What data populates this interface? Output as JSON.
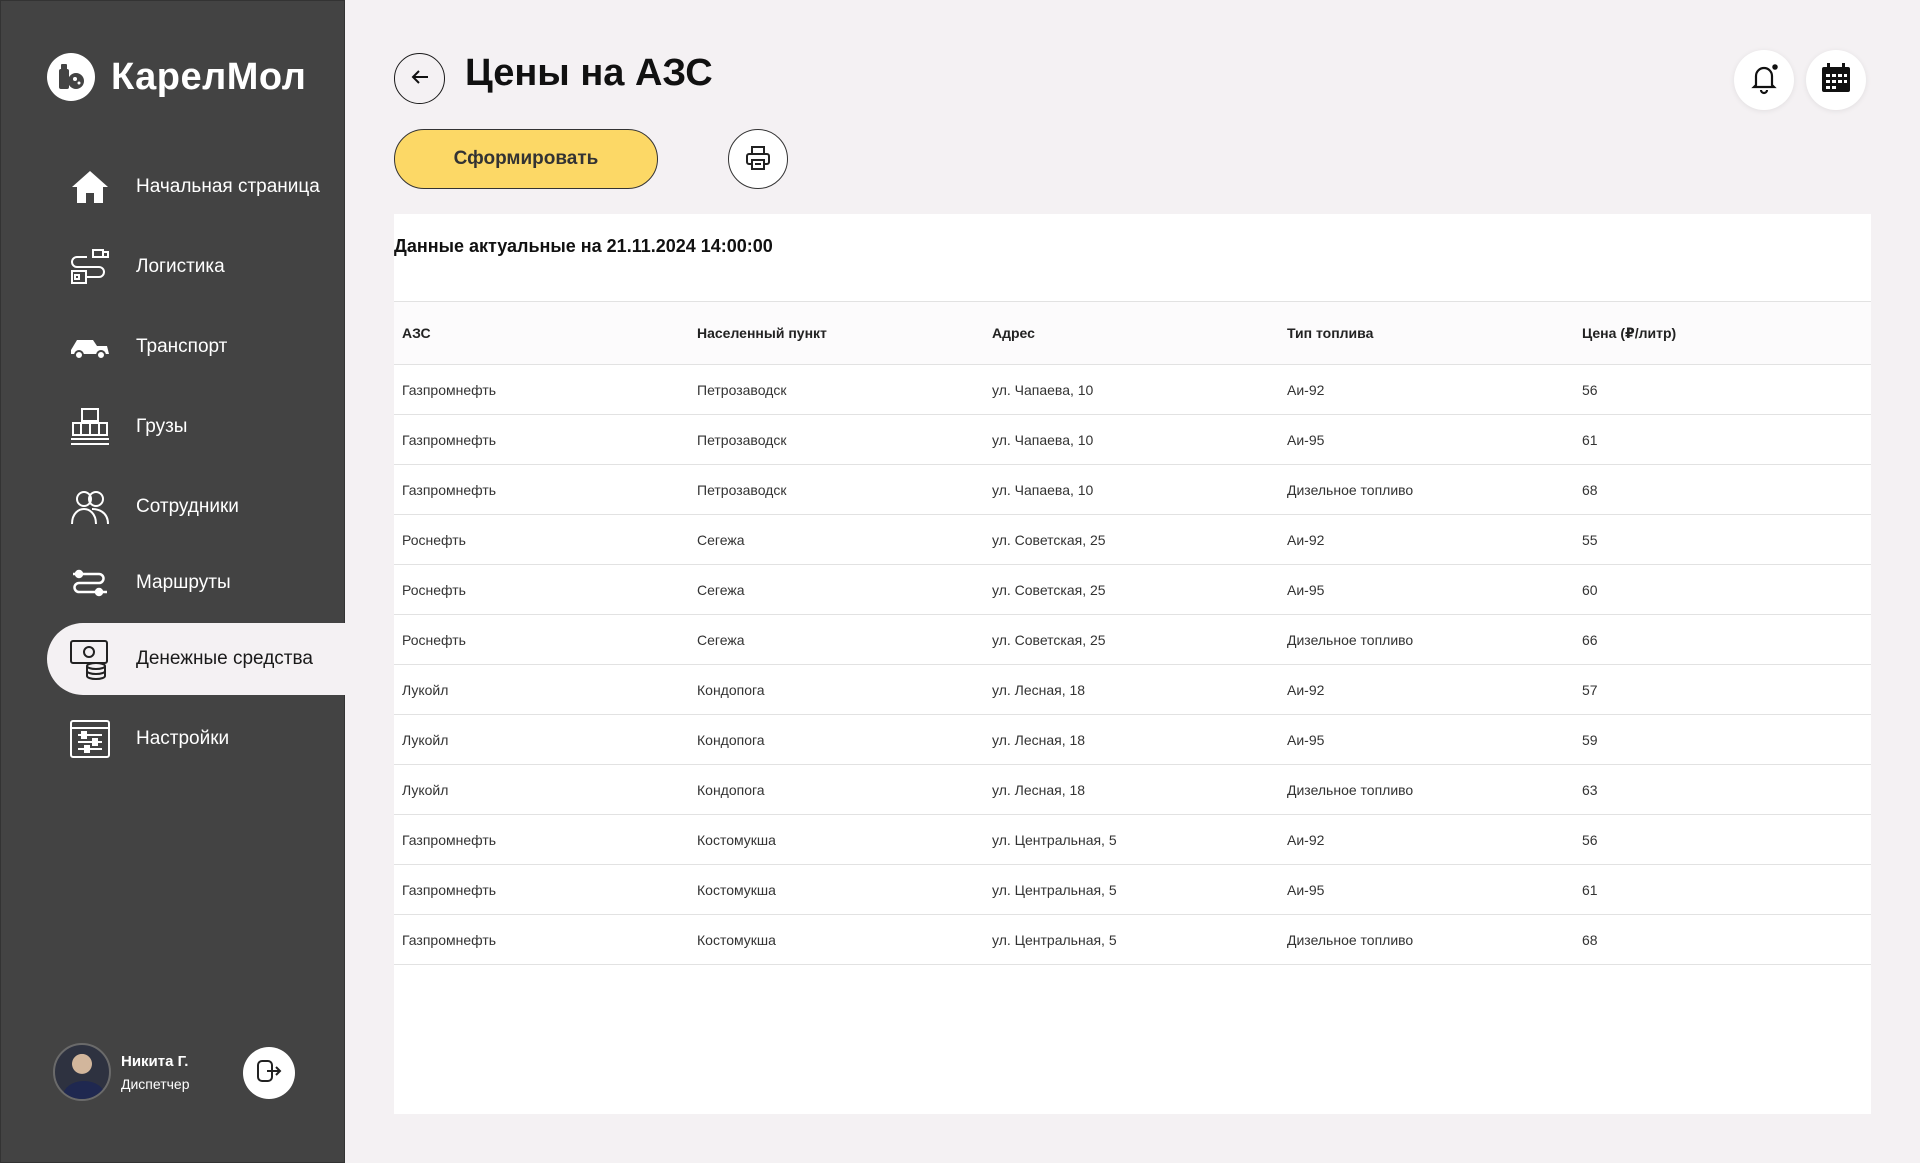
{
  "brand": {
    "name": "КарелМол"
  },
  "sidebar": {
    "items": [
      {
        "label": "Начальная страница",
        "icon": "home-icon"
      },
      {
        "label": "Логистика",
        "icon": "logistics-icon"
      },
      {
        "label": "Транспорт",
        "icon": "transport-icon"
      },
      {
        "label": "Грузы",
        "icon": "cargo-icon"
      },
      {
        "label": "Сотрудники",
        "icon": "employees-icon"
      },
      {
        "label": "Маршруты",
        "icon": "routes-icon"
      },
      {
        "label": "Денежные средства",
        "icon": "money-icon",
        "active": true
      },
      {
        "label": "Настройки",
        "icon": "settings-icon"
      }
    ]
  },
  "user": {
    "name": "Никита Г.",
    "role": "Диспетчер"
  },
  "header": {
    "title": "Цены на АЗС"
  },
  "toolbar": {
    "generate_label": "Сформировать"
  },
  "card": {
    "info": "Данные актуальные на 21.11.2024 14:00:00"
  },
  "table": {
    "columns": [
      "АЗС",
      "Населенный пункт",
      "Адрес",
      "Тип топлива",
      "Цена (₽/литр)"
    ],
    "rows": [
      [
        "Газпромнефть",
        "Петрозаводск",
        "ул. Чапаева, 10",
        "Аи-92",
        "56"
      ],
      [
        "Газпромнефть",
        "Петрозаводск",
        "ул. Чапаева, 10",
        "Аи-95",
        "61"
      ],
      [
        "Газпромнефть",
        "Петрозаводск",
        "ул. Чапаева, 10",
        "Дизельное топливо",
        "68"
      ],
      [
        "Роснефть",
        "Сегежа",
        "ул. Советская, 25",
        "Аи-92",
        "55"
      ],
      [
        "Роснефть",
        "Сегежа",
        "ул. Советская, 25",
        "Аи-95",
        "60"
      ],
      [
        "Роснефть",
        "Сегежа",
        "ул. Советская, 25",
        "Дизельное топливо",
        "66"
      ],
      [
        "Лукойл",
        "Кондопога",
        "ул. Лесная, 18",
        "Аи-92",
        "57"
      ],
      [
        "Лукойл",
        "Кондопога",
        "ул. Лесная, 18",
        "Аи-95",
        "59"
      ],
      [
        "Лукойл",
        "Кондопога",
        "ул. Лесная, 18",
        "Дизельное топливо",
        "63"
      ],
      [
        "Газпромнефть",
        "Костомукша",
        "ул. Центральная, 5",
        "Аи-92",
        "56"
      ],
      [
        "Газпромнефть",
        "Костомукша",
        "ул. Центральная, 5",
        "Аи-95",
        "61"
      ],
      [
        "Газпромнефть",
        "Костомукша",
        "ул. Центральная, 5",
        "Дизельное топливо",
        "68"
      ]
    ]
  },
  "colors": {
    "sidebar_bg": "#434343",
    "page_bg": "#f4f1f3",
    "accent_button": "#fcd866"
  }
}
